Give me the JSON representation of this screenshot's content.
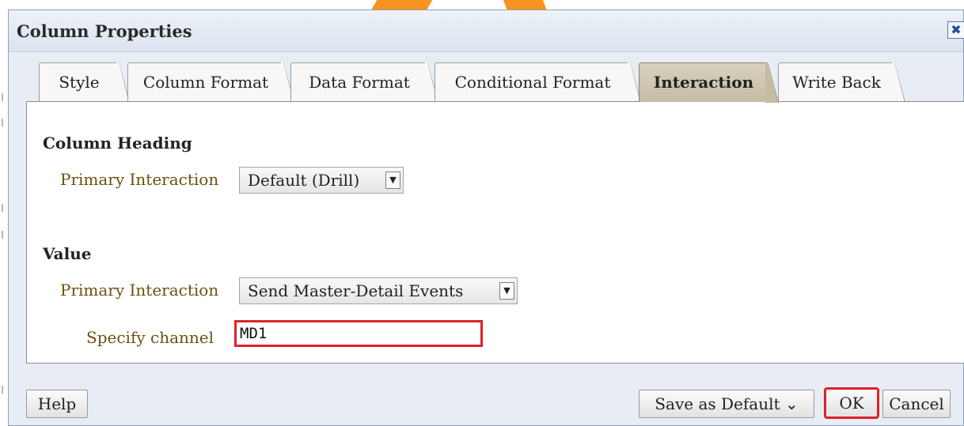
{
  "dialog": {
    "title": "Column Properties",
    "close_icon_glyph": "✖"
  },
  "tabs": [
    {
      "label": "Style",
      "active": false
    },
    {
      "label": "Column Format",
      "active": false
    },
    {
      "label": "Data Format",
      "active": false
    },
    {
      "label": "Conditional Format",
      "active": false
    },
    {
      "label": "Interaction",
      "active": true
    },
    {
      "label": "Write Back",
      "active": false
    }
  ],
  "column_heading": {
    "title": "Column Heading",
    "primary_interaction_label": "Primary Interaction",
    "primary_interaction_value": "Default (Drill)"
  },
  "value_section": {
    "title": "Value",
    "primary_interaction_label": "Primary Interaction",
    "primary_interaction_value": "Send Master-Detail Events",
    "channel_label": "Specify channel",
    "channel_value": "MD1"
  },
  "footer": {
    "help_label": "Help",
    "save_default_label": "Save as Default",
    "ok_label": "OK",
    "cancel_label": "Cancel"
  },
  "icons": {
    "dropdown_arrow": "▼",
    "save_default_chevron": "⌄"
  },
  "colors": {
    "highlight": "#e0202a",
    "label_brown": "#6e4f0e",
    "active_tab": "#c5bca3"
  }
}
